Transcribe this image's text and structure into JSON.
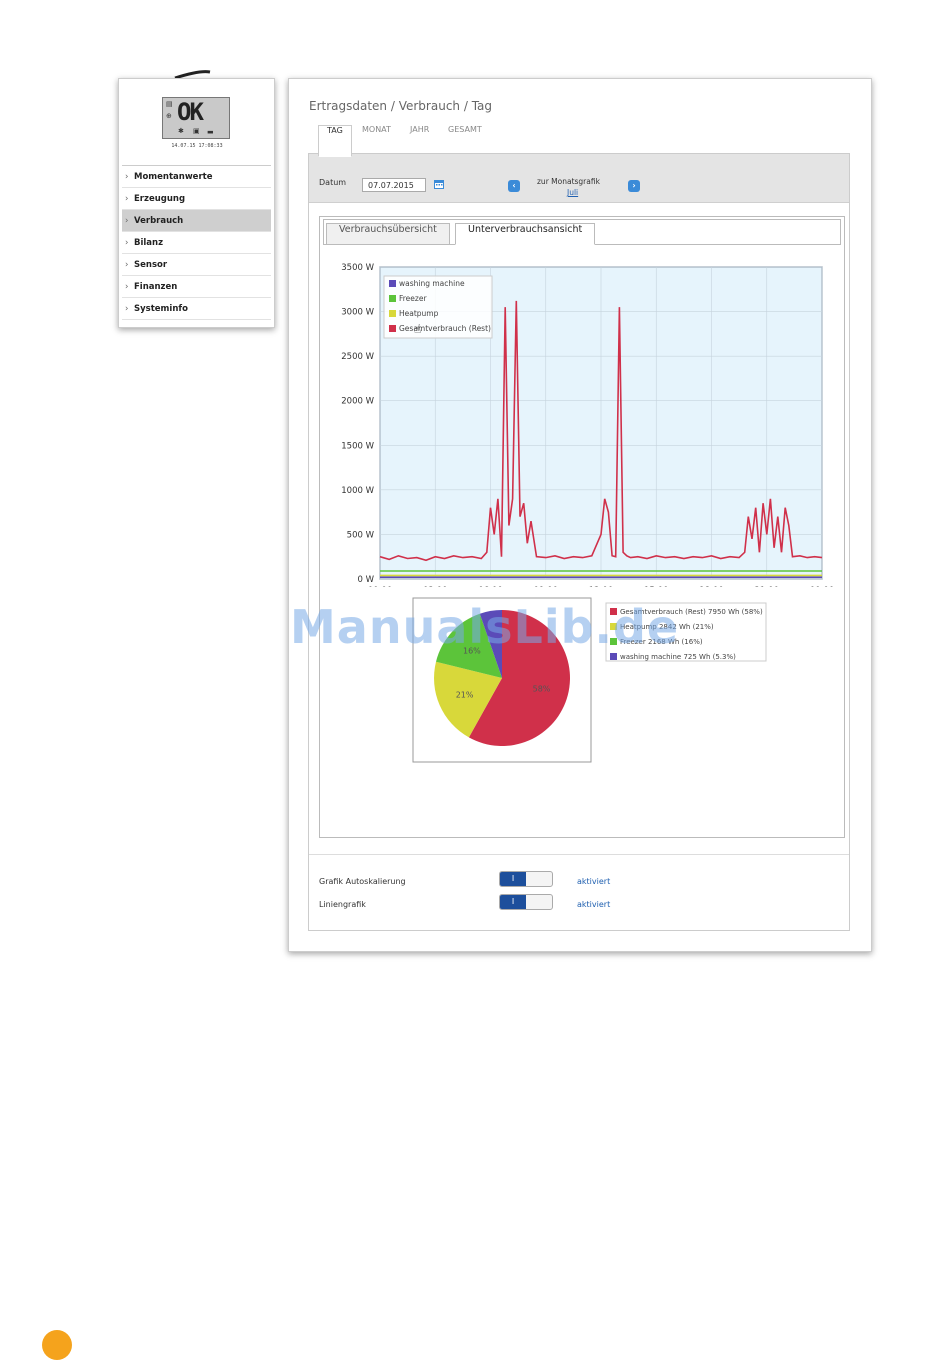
{
  "sidebar": {
    "lcd_text": "OK",
    "lcd_date": "14.07.15 17:08:33",
    "items": [
      {
        "label": "Momentanwerte",
        "active": false
      },
      {
        "label": "Erzeugung",
        "active": false
      },
      {
        "label": "Verbrauch",
        "active": true
      },
      {
        "label": "Bilanz",
        "active": false
      },
      {
        "label": "Sensor",
        "active": false
      },
      {
        "label": "Finanzen",
        "active": false
      },
      {
        "label": "Systeminfo",
        "active": false
      }
    ]
  },
  "main": {
    "breadcrumb": "Ertragsdaten / Verbrauch / Tag",
    "tabs": [
      "TAG",
      "MONAT",
      "JAHR",
      "GESAMT"
    ],
    "active_tab": "TAG",
    "datum_label": "Datum",
    "date_value": "07.07.2015",
    "month_label": "zur Monatsgrafik",
    "month_link": "Juli",
    "subtabs": [
      "Verbrauchsübersicht",
      "Unterverbrauchsansicht"
    ],
    "active_subtab": "Unterverbrauchsansicht",
    "options": [
      {
        "label": "Grafik Autoskalierung",
        "value": "aktiviert",
        "toggle": "I"
      },
      {
        "label": "Liniengrafik",
        "value": "aktiviert",
        "toggle": "I"
      }
    ]
  },
  "watermark": "ManualsLib.de",
  "colors": {
    "washing_machine": "#5b4bb8",
    "freezer": "#5cc43a",
    "heatpump": "#d8d83a",
    "gesamt": "#d0304a",
    "plot_bg": "#e6f4fc",
    "accent": "#1d4f9c"
  },
  "chart_data": [
    {
      "type": "line",
      "ylim": [
        0,
        3500
      ],
      "yticks": [
        "3500 W",
        "3000 W",
        "2500 W",
        "2000 W",
        "1500 W",
        "1000 W",
        "500 W",
        "0 W"
      ],
      "ytick_values": [
        3500,
        3000,
        2500,
        2000,
        1500,
        1000,
        500,
        0
      ],
      "xticks": [
        "00:00",
        "03:00",
        "06:00",
        "09:00",
        "12:00",
        "15:00",
        "18:00",
        "21:00",
        "00:00"
      ],
      "xlim": [
        0,
        24
      ],
      "grid": true,
      "legend": "top-left",
      "series": [
        {
          "name": "washing machine",
          "color": "#5b4bb8",
          "x": [
            0,
            24
          ],
          "y": [
            20,
            20
          ]
        },
        {
          "name": "Freezer",
          "color": "#5cc43a",
          "x": [
            0,
            24
          ],
          "y": [
            90,
            90
          ]
        },
        {
          "name": "Heatpump",
          "color": "#d8d83a",
          "x": [
            0,
            24
          ],
          "y": [
            40,
            40
          ]
        },
        {
          "name": "Gesamtverbrauch (Rest)",
          "color": "#d0304a",
          "x": [
            0,
            0.5,
            1,
            1.5,
            2,
            2.5,
            3,
            3.5,
            4,
            4.5,
            5,
            5.5,
            5.8,
            6.0,
            6.2,
            6.4,
            6.6,
            6.8,
            7.0,
            7.2,
            7.4,
            7.6,
            7.8,
            8.0,
            8.2,
            8.5,
            9,
            9.5,
            10,
            10.5,
            11,
            11.5,
            12.0,
            12.2,
            12.4,
            12.6,
            12.8,
            13.0,
            13.2,
            13.4,
            13.6,
            14,
            14.5,
            15,
            15.5,
            16,
            16.5,
            17,
            17.5,
            18,
            18.5,
            19,
            19.5,
            19.8,
            20.0,
            20.2,
            20.4,
            20.6,
            20.8,
            21.0,
            21.2,
            21.4,
            21.6,
            21.8,
            22.0,
            22.2,
            22.4,
            22.8,
            23.2,
            23.6,
            24
          ],
          "y": [
            250,
            220,
            260,
            230,
            240,
            210,
            250,
            230,
            260,
            240,
            250,
            230,
            300,
            800,
            500,
            900,
            250,
            3050,
            600,
            900,
            3120,
            700,
            850,
            400,
            650,
            250,
            240,
            260,
            230,
            250,
            240,
            260,
            500,
            900,
            750,
            260,
            250,
            3050,
            300,
            260,
            240,
            250,
            230,
            260,
            240,
            250,
            230,
            250,
            240,
            260,
            230,
            250,
            240,
            300,
            700,
            450,
            800,
            300,
            850,
            500,
            900,
            350,
            700,
            300,
            800,
            600,
            250,
            260,
            240,
            250,
            240
          ]
        }
      ]
    },
    {
      "type": "pie",
      "slices": [
        {
          "name": "Gesamtverbrauch (Rest)",
          "value": 7950,
          "unit": "Wh",
          "percent": 58,
          "label": "58%",
          "legend": "Gesamtverbrauch (Rest) 7950 Wh (58%)",
          "color": "#d0304a"
        },
        {
          "name": "Heatpump",
          "value": 2842,
          "unit": "Wh",
          "percent": 21,
          "label": "21%",
          "legend": "Heatpump 2842 Wh (21%)",
          "color": "#d8d83a"
        },
        {
          "name": "Freezer",
          "value": 2168,
          "unit": "Wh",
          "percent": 16,
          "label": "16%",
          "legend": "Freezer 2168 Wh (16%)",
          "color": "#5cc43a"
        },
        {
          "name": "washing machine",
          "value": 725,
          "unit": "Wh",
          "percent": 5.3,
          "label": "",
          "legend": "washing machine 725 Wh (5.3%)",
          "color": "#5b4bb8"
        }
      ],
      "legend": "right"
    }
  ]
}
